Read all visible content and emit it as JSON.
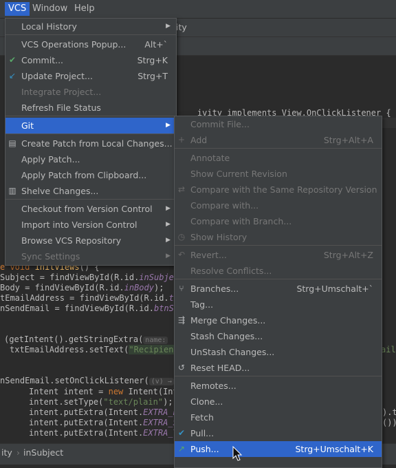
{
  "menubar": {
    "vcs": "VCS",
    "window": "Window",
    "help": "Help"
  },
  "bg": {
    "crumb_fragment": "ity",
    "code_header": "ivity implements View.OnClickListener {",
    "lines": [
      {
        "a": "e void ",
        "b": "initViews",
        "c": "() {"
      },
      {
        "a": "Subject = findViewById(R.id.",
        "f": "inSubject"
      },
      {
        "a": "Body = findViewById(R.id.",
        "f": "inBody",
        "c": ");"
      },
      {
        "a": "tEmailAddress = findViewById(R.id.",
        "f": "tx"
      },
      {
        "a": "nSendEmail = findViewById(R.id.",
        "f": "btnSe"
      }
    ],
    "intent_line": "(getIntent().getStringExtra(",
    "intent_hint": "name:",
    "set_text_line": "txtEmailAddress.setText(",
    "set_text_str": "\"Recipient",
    "set_text_tail": "ail",
    "listener_line": "nSendEmail.setOnClickListener(",
    "listener_hint": "(v) →",
    "intent_new_a": "Intent intent = ",
    "intent_new_kw": "new",
    "intent_new_b": " Intent(Int",
    "set_type_a": "intent.setType(",
    "set_type_str": "\"text/plain\"",
    "set_type_b": ");",
    "put_lines": [
      {
        "a": "intent.putExtra(Intent.",
        "f": "EXTRA_E",
        "tail": ").t"
      },
      {
        "a": "intent.putExtra(Intent.",
        "f": "EXTRA_S",
        "tail": "())"
      },
      {
        "a": "intent.putExtra(Intent.",
        "f": "EXTRA_T",
        "tail": ""
      }
    ],
    "status_left": "ity",
    "status_crumb": "inSubject"
  },
  "vcs_menu": {
    "items": [
      {
        "label": "Local History",
        "sub": true
      },
      {
        "label": "VCS Operations Popup...",
        "shortcut": "Alt+`"
      },
      {
        "label": "Commit...",
        "shortcut": "Strg+K",
        "icon": "check-icon"
      },
      {
        "label": "Update Project...",
        "shortcut": "Strg+T",
        "icon": "update-icon"
      },
      {
        "label": "Integrate Project...",
        "disabled": true
      },
      {
        "label": "Refresh File Status"
      },
      {
        "label": "Git",
        "sub": true,
        "selected": true
      },
      {
        "label": "Create Patch from Local Changes...",
        "icon": "patch-icon"
      },
      {
        "label": "Apply Patch..."
      },
      {
        "label": "Apply Patch from Clipboard..."
      },
      {
        "label": "Shelve Changes...",
        "icon": "shelve-icon"
      },
      {
        "label": "Checkout from Version Control",
        "sub": true
      },
      {
        "label": "Import into Version Control",
        "sub": true
      },
      {
        "label": "Browse VCS Repository",
        "sub": true
      },
      {
        "label": "Sync Settings",
        "sub": true,
        "disabled": true
      }
    ]
  },
  "git_menu": {
    "items": [
      {
        "label": "Commit File...",
        "disabled": true
      },
      {
        "label": "Add",
        "shortcut": "Strg+Alt+A",
        "disabled": true,
        "icon": "plus-icon"
      },
      {
        "label": "Annotate",
        "disabled": true
      },
      {
        "label": "Show Current Revision",
        "disabled": true
      },
      {
        "label": "Compare with the Same Repository Version",
        "disabled": true,
        "icon": "compare-icon"
      },
      {
        "label": "Compare with...",
        "disabled": true
      },
      {
        "label": "Compare with Branch...",
        "disabled": true
      },
      {
        "label": "Show History",
        "disabled": true,
        "icon": "clock-icon"
      },
      {
        "label": "Revert...",
        "shortcut": "Strg+Alt+Z",
        "disabled": true,
        "icon": "revert-icon"
      },
      {
        "label": "Resolve Conflicts...",
        "disabled": true
      },
      {
        "label": "Branches...",
        "shortcut": "Strg+Umschalt+`",
        "icon": "branch-icon"
      },
      {
        "label": "Tag..."
      },
      {
        "label": "Merge Changes...",
        "icon": "merge-icon"
      },
      {
        "label": "Stash Changes..."
      },
      {
        "label": "UnStash Changes..."
      },
      {
        "label": "Reset HEAD...",
        "icon": "reset-icon"
      },
      {
        "label": "Remotes..."
      },
      {
        "label": "Clone..."
      },
      {
        "label": "Fetch"
      },
      {
        "label": "Pull...",
        "icon": "pull-icon"
      },
      {
        "label": "Push...",
        "shortcut": "Strg+Umschalt+K",
        "selected": true,
        "icon": "push-icon"
      }
    ]
  },
  "colors": {
    "accent": "#2f65ca",
    "menu_bg": "#3c3f41",
    "editor_bg": "#2b2b2b",
    "keyword": "#cc7832",
    "field": "#9876aa",
    "string": "#6a8759"
  }
}
